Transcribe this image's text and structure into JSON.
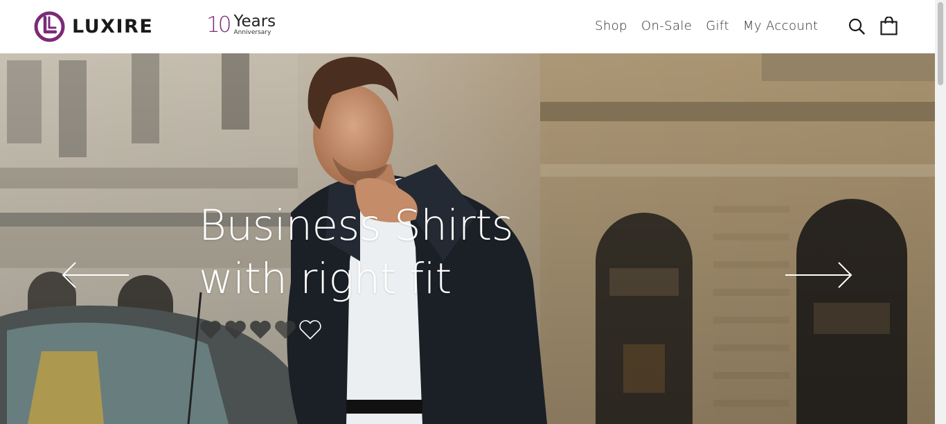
{
  "header": {
    "logo_text": "LUXIRE",
    "anniversary": {
      "number": "10",
      "word": "Years",
      "sub": "Anniversary"
    },
    "nav": [
      {
        "label": "Shop"
      },
      {
        "label": "On-Sale"
      },
      {
        "label": "Gift"
      },
      {
        "label": "My Account"
      }
    ],
    "icons": {
      "search": "search-icon",
      "cart": "shopping-bag-icon"
    }
  },
  "hero": {
    "title_line1": "Business Shirts",
    "title_line2": "with right fit",
    "rating": {
      "value": 4,
      "max": 5
    },
    "prev_icon": "arrow-left-icon",
    "next_icon": "arrow-right-icon"
  },
  "colors": {
    "brand_purple": "#7b2a79",
    "text_dark": "#2b2b2b",
    "hero_text": "#ffffff",
    "heart_fill": "#3a3a3a"
  }
}
